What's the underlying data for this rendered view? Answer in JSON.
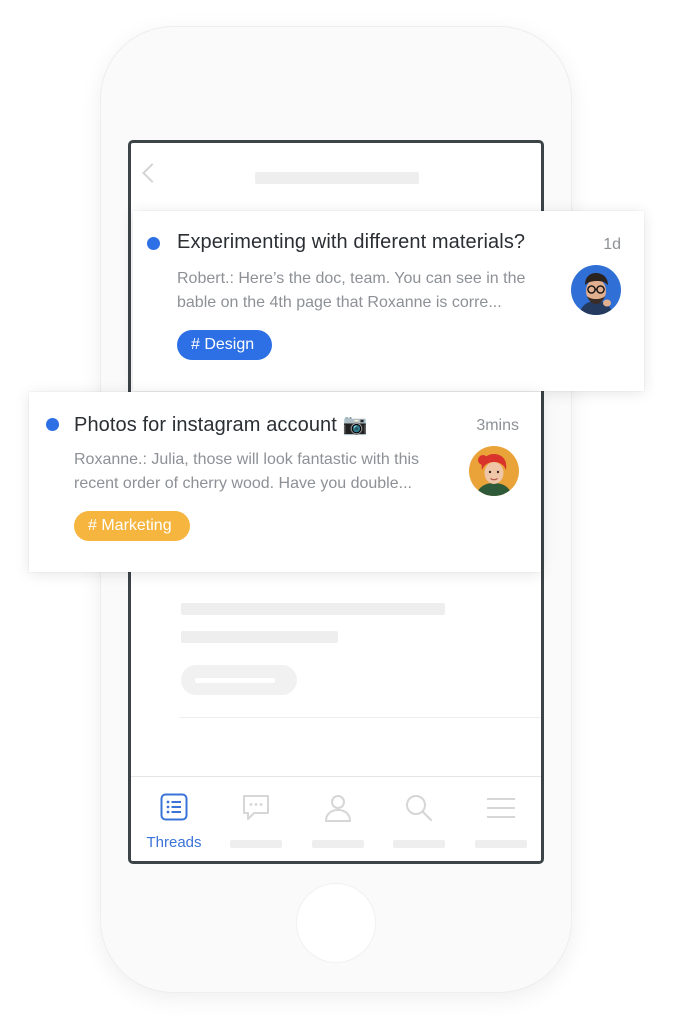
{
  "colors": {
    "accent": "#2d6fe4",
    "design_tag": "#2d6fe4",
    "marketing_tag": "#f5b53f",
    "frame": "#3c4447"
  },
  "tabbar": {
    "threads_label": "Threads",
    "icons": [
      "threads-list-icon",
      "chat-bubble-icon",
      "person-icon",
      "search-icon",
      "menu-icon"
    ]
  },
  "threads": [
    {
      "unread": true,
      "title": "Experimenting with different materials?",
      "time": "1d",
      "preview_line1": "Robert.: Here’s the doc, team. You can see in the",
      "preview_line2": "bable on the 4th page that Roxanne is corre...",
      "tag": "# Design",
      "tag_color": "#2d6fe4",
      "avatar": "man-with-glasses-avatar"
    },
    {
      "unread": true,
      "title": "Photos for instagram account 📷",
      "time": "3mins",
      "preview_line1": "Roxanne.: Julia, those will look fantastic with this",
      "preview_line2": "recent order of cherry wood. Have you double...",
      "tag": "# Marketing",
      "tag_color": "#f5b53f",
      "avatar": "woman-red-hair-avatar"
    }
  ]
}
